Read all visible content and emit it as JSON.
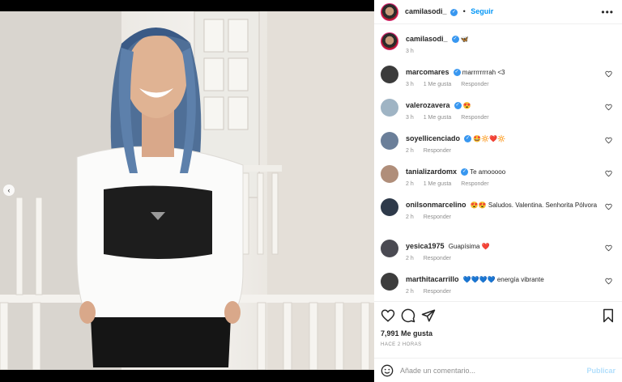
{
  "header": {
    "username": "camilasodi_",
    "separator": "•",
    "follow_label": "Seguir",
    "more_label": "•••"
  },
  "caption": {
    "username": "camilasodi_",
    "text": "🦋",
    "time": "3 h"
  },
  "comments": [
    {
      "username": "marcomares",
      "verified": true,
      "text": "marrrrrrrrah <3",
      "time": "3 h",
      "likes": "1 Me gusta",
      "reply": "Responder"
    },
    {
      "username": "valerozavera",
      "verified": true,
      "text": "😍",
      "time": "3 h",
      "likes": "1 Me gusta",
      "reply": "Responder"
    },
    {
      "username": "soyellicenciado",
      "verified": true,
      "text": "🤩🔆❤️🔆",
      "time": "2 h",
      "likes": "",
      "reply": "Responder"
    },
    {
      "username": "tanializardomx",
      "verified": true,
      "text": "Te amooooo",
      "time": "2 h",
      "likes": "1 Me gusta",
      "reply": "Responder"
    },
    {
      "username": "onilsonmarcelino",
      "verified": false,
      "text": "😍😍 Saludos. Valentina. Senhorita Pólvora",
      "time": "2 h",
      "likes": "",
      "reply": "Responder"
    },
    {
      "username": "yesica1975",
      "verified": false,
      "text": "Guapísima ❤️",
      "time": "2 h",
      "likes": "",
      "reply": "Responder"
    },
    {
      "username": "marthitacarrillo",
      "verified": false,
      "text": "💙💙💙💙 energía vibrante",
      "time": "2 h",
      "likes": "",
      "reply": "Responder"
    }
  ],
  "actions": {
    "like_icon": "heart-icon",
    "comment_icon": "comment-icon",
    "share_icon": "paper-plane-icon",
    "save_icon": "bookmark-icon"
  },
  "likes_count": "7,991 Me gusta",
  "posted_ago": "HACE 2 HORAS",
  "composer": {
    "placeholder": "Añade un comentario...",
    "publish_label": "Publicar",
    "emoji_icon": "smiley-icon"
  },
  "carousel": {
    "prev_icon": "chevron-left-icon",
    "prev_label": "‹"
  },
  "colors": {
    "accent": "#0095f6",
    "verified": "#3897f0",
    "muted": "#8e8e8e",
    "publish_disabled": "#b2dffc"
  }
}
